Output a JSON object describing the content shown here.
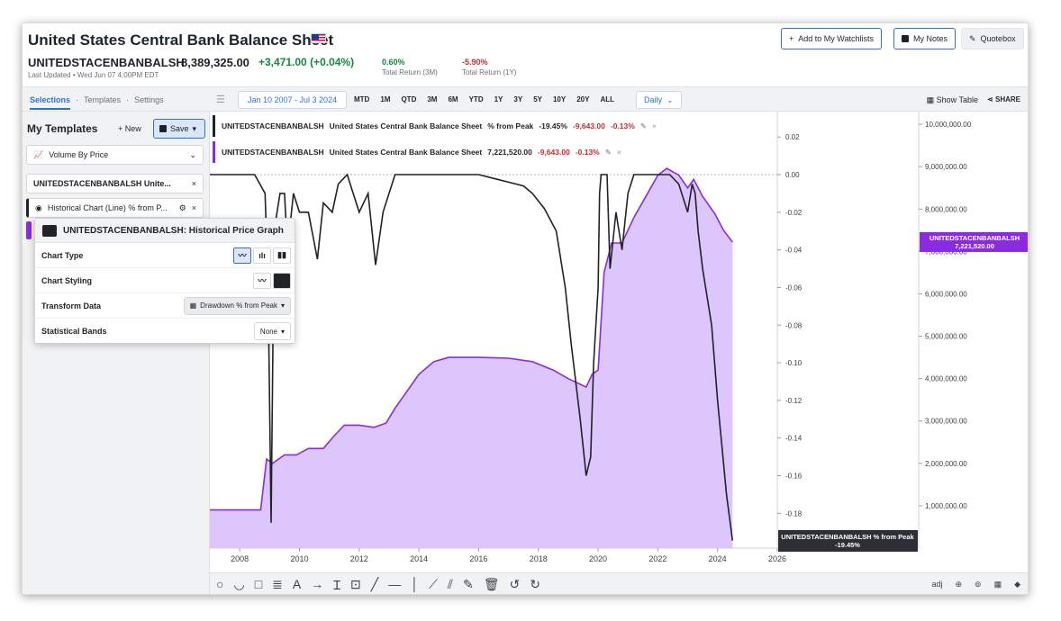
{
  "header": {
    "title": "United States Central Bank Balance Sheet",
    "ticker": "UNITEDSTACENBANBALSH",
    "price": "8,389,325.00",
    "change": "+3,471.00",
    "change_pct": "(+0.04%)",
    "updated": "Last Updated • Wed Jun 07 4:00PM EDT",
    "return_3m_value": "0.60%",
    "return_3m_label": "Total Return (3M)",
    "return_1y_value": "-5.90%",
    "return_1y_label": "Total Return (1Y)",
    "watchlist_label": "Add to My Watchlists",
    "notes_label": "My Notes",
    "quotebox_label": "Quotebox"
  },
  "toolbar": {
    "tabs": [
      "Selections",
      "Templates",
      "Settings"
    ],
    "date_range": "Jan 10 2007 - Jul 3 2024",
    "periods": [
      "MTD",
      "1M",
      "QTD",
      "3M",
      "6M",
      "YTD",
      "1Y",
      "3Y",
      "5Y",
      "10Y",
      "20Y",
      "ALL"
    ],
    "interval": "Daily",
    "show_table": "Show Table",
    "share": "SHARE"
  },
  "sidebar": {
    "my_templates": "My Templates",
    "new_label": "+ New",
    "save_label": "Save",
    "template_select": "Volume By Price",
    "series_item": "UNITEDSTACENBANBALSH  Unite...",
    "study_item": "Historical Chart (Line) % from P..."
  },
  "popup": {
    "title": "UNITEDSTACENBANBALSH: Historical Price Graph",
    "rows": [
      {
        "label": "Chart Type"
      },
      {
        "label": "Chart Styling"
      },
      {
        "label": "Transform Data",
        "value": "Drawdown % from Peak"
      },
      {
        "label": "Statistical Bands",
        "value": "None"
      }
    ]
  },
  "legend": {
    "line1": {
      "ticker": "UNITEDSTACENBANBALSH",
      "name": "United States Central Bank Balance Sheet",
      "metric": "% from Peak",
      "value": "-19.45%",
      "change": "-9,643.00",
      "change_pct": "-0.13%"
    },
    "line2": {
      "ticker": "UNITEDSTACENBANBALSH",
      "name": "United States Central Bank Balance Sheet",
      "value": "7,221,520.00",
      "change": "-9,643.00",
      "change_pct": "-0.13%"
    }
  },
  "colors": {
    "drawdown_line": "#1f2328",
    "balance_line": "#8a2be2",
    "balance_fill": "#dcc6fb",
    "accent": "#2f6fd6"
  },
  "chart_data": {
    "type": "line",
    "x_ticks": [
      "2008",
      "2010",
      "2012",
      "2014",
      "2016",
      "2018",
      "2020",
      "2022",
      "2024",
      "2026"
    ],
    "xlim": [
      2007.0,
      2026.0
    ],
    "right_axis": {
      "ticks": [
        0.02,
        0.0,
        -0.02,
        -0.04,
        -0.06,
        -0.08,
        -0.1,
        -0.12,
        -0.14,
        -0.16,
        -0.18
      ],
      "ylim": [
        -0.1985,
        0.0335
      ]
    },
    "left_axis": {
      "ticks": [
        "10,000,000.00",
        "9,000,000.00",
        "8,000,000.00",
        "7,000,000.00",
        "6,000,000.00",
        "5,000,000.00",
        "4,000,000.00",
        "3,000,000.00",
        "2,000,000.00",
        "1,000,000.00"
      ],
      "ylim": [
        0,
        10300000
      ]
    },
    "series": [
      {
        "name": "UNITEDSTACENBANBALSH % from Peak",
        "axis": "right",
        "end_label": "-19.45%",
        "points": [
          [
            2007.0,
            0.0
          ],
          [
            2008.0,
            0.0
          ],
          [
            2008.5,
            0.0
          ],
          [
            2008.85,
            -0.01
          ],
          [
            2008.95,
            -0.06
          ],
          [
            2009.05,
            -0.185
          ],
          [
            2009.15,
            -0.03
          ],
          [
            2009.35,
            -0.01
          ],
          [
            2009.5,
            -0.01
          ],
          [
            2009.6,
            -0.04
          ],
          [
            2009.8,
            -0.01
          ],
          [
            2010.0,
            -0.02
          ],
          [
            2010.3,
            -0.02
          ],
          [
            2010.6,
            -0.045
          ],
          [
            2010.8,
            -0.015
          ],
          [
            2011.1,
            -0.02
          ],
          [
            2011.3,
            -0.005
          ],
          [
            2011.6,
            -0.0
          ],
          [
            2012.0,
            -0.02
          ],
          [
            2012.3,
            -0.01
          ],
          [
            2012.55,
            -0.048
          ],
          [
            2012.8,
            -0.02
          ],
          [
            2013.2,
            0.0
          ],
          [
            2014.0,
            0.0
          ],
          [
            2015.0,
            0.0
          ],
          [
            2016.0,
            0.0
          ],
          [
            2016.5,
            -0.002
          ],
          [
            2017.0,
            -0.004
          ],
          [
            2017.5,
            -0.006
          ],
          [
            2017.8,
            -0.01
          ],
          [
            2018.2,
            -0.018
          ],
          [
            2018.6,
            -0.03
          ],
          [
            2018.9,
            -0.06
          ],
          [
            2019.1,
            -0.09
          ],
          [
            2019.4,
            -0.13
          ],
          [
            2019.6,
            -0.16
          ],
          [
            2019.75,
            -0.15
          ],
          [
            2019.85,
            -0.1
          ],
          [
            2020.0,
            -0.06
          ],
          [
            2020.05,
            -0.01
          ],
          [
            2020.1,
            0.0
          ],
          [
            2020.3,
            0.0
          ],
          [
            2020.4,
            -0.05
          ],
          [
            2020.6,
            -0.02
          ],
          [
            2020.8,
            -0.04
          ],
          [
            2021.0,
            -0.01
          ],
          [
            2021.2,
            0.0
          ],
          [
            2022.0,
            0.0
          ],
          [
            2022.4,
            0.0
          ],
          [
            2022.7,
            -0.005
          ],
          [
            2023.0,
            -0.02
          ],
          [
            2023.15,
            -0.005
          ],
          [
            2023.25,
            -0.01
          ],
          [
            2023.35,
            -0.03
          ],
          [
            2023.5,
            -0.05
          ],
          [
            2023.8,
            -0.08
          ],
          [
            2024.0,
            -0.12
          ],
          [
            2024.3,
            -0.17
          ],
          [
            2024.5,
            -0.1945
          ]
        ]
      },
      {
        "name": "UNITEDSTACENBANBALSH",
        "axis": "left",
        "end_label": "7,221,520.00",
        "points": [
          [
            2007.0,
            900000
          ],
          [
            2008.0,
            900000
          ],
          [
            2008.7,
            900000
          ],
          [
            2008.9,
            2100000
          ],
          [
            2009.1,
            2000000
          ],
          [
            2009.5,
            2200000
          ],
          [
            2009.9,
            2200000
          ],
          [
            2010.3,
            2350000
          ],
          [
            2010.8,
            2350000
          ],
          [
            2011.1,
            2600000
          ],
          [
            2011.5,
            2900000
          ],
          [
            2012.0,
            2900000
          ],
          [
            2012.5,
            2850000
          ],
          [
            2012.9,
            2950000
          ],
          [
            2013.2,
            3300000
          ],
          [
            2013.6,
            3700000
          ],
          [
            2014.0,
            4100000
          ],
          [
            2014.5,
            4400000
          ],
          [
            2015.0,
            4500000
          ],
          [
            2016.0,
            4500000
          ],
          [
            2017.0,
            4480000
          ],
          [
            2017.8,
            4400000
          ],
          [
            2018.5,
            4200000
          ],
          [
            2019.0,
            4000000
          ],
          [
            2019.6,
            3800000
          ],
          [
            2019.8,
            4100000
          ],
          [
            2020.0,
            4200000
          ],
          [
            2020.2,
            6500000
          ],
          [
            2020.45,
            7200000
          ],
          [
            2020.8,
            7200000
          ],
          [
            2021.2,
            7800000
          ],
          [
            2021.6,
            8300000
          ],
          [
            2022.0,
            8800000
          ],
          [
            2022.3,
            8960000
          ],
          [
            2022.7,
            8800000
          ],
          [
            2023.0,
            8500000
          ],
          [
            2023.2,
            8700000
          ],
          [
            2023.5,
            8300000
          ],
          [
            2023.9,
            7900000
          ],
          [
            2024.2,
            7500000
          ],
          [
            2024.5,
            7221520
          ]
        ]
      }
    ]
  }
}
